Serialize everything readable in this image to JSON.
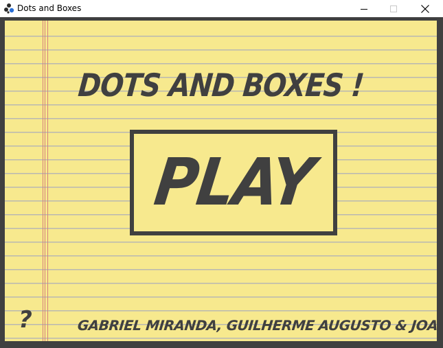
{
  "window": {
    "title": "Dots and Boxes",
    "app_icon": "dots-boxes-app-icon",
    "controls": {
      "minimize": "minimize-icon",
      "maximize": "maximize-icon",
      "close": "close-icon"
    }
  },
  "game": {
    "title": "DOTS AND BOXES !",
    "play_label": "PLAY",
    "help_label": "?",
    "credits": "GABRIEL MIRANDA, GUILHERME AUGUSTO & JOAO VICTOR"
  },
  "colors": {
    "paper": "#f7e98e",
    "ink": "#404040",
    "rule_line": "#b8b8b2",
    "margin_line": "#d6807a"
  }
}
